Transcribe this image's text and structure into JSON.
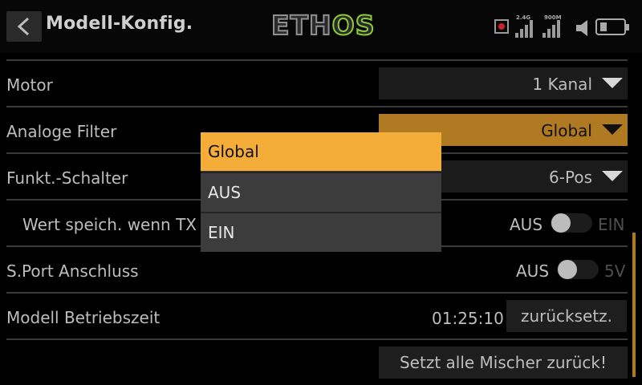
{
  "header": {
    "title": "Modell-Konfig.",
    "logo_main": "ETH",
    "logo_accent": "OS",
    "signal1_label": "2.4G",
    "signal2_label": "900M"
  },
  "rows": {
    "motor": {
      "label": "Motor",
      "value": "1 Kanal"
    },
    "analog_filter": {
      "label": "Analoge Filter",
      "value": "Global"
    },
    "func_switch": {
      "label": "Funkt.-Schalter",
      "value": "6-Pos"
    },
    "save_value": {
      "label": "Wert speich. wenn TX",
      "off": "AUS",
      "on": "EIN"
    },
    "sport": {
      "label": "S.Port Anschluss",
      "off": "AUS",
      "on": "5V"
    },
    "runtime": {
      "label": "Modell Betriebszeit",
      "time": "01:25:10",
      "reset": "zurücksetz."
    },
    "reset_mixers": "Setzt alle Mischer zurück!"
  },
  "popup": {
    "options": [
      "Global",
      "AUS",
      "EIN"
    ],
    "selected": "Global"
  },
  "colors": {
    "accent": "#f5ad3a",
    "accent_dim": "#b07a22",
    "logo_green": "#8ecb3a",
    "background": "#000000"
  }
}
